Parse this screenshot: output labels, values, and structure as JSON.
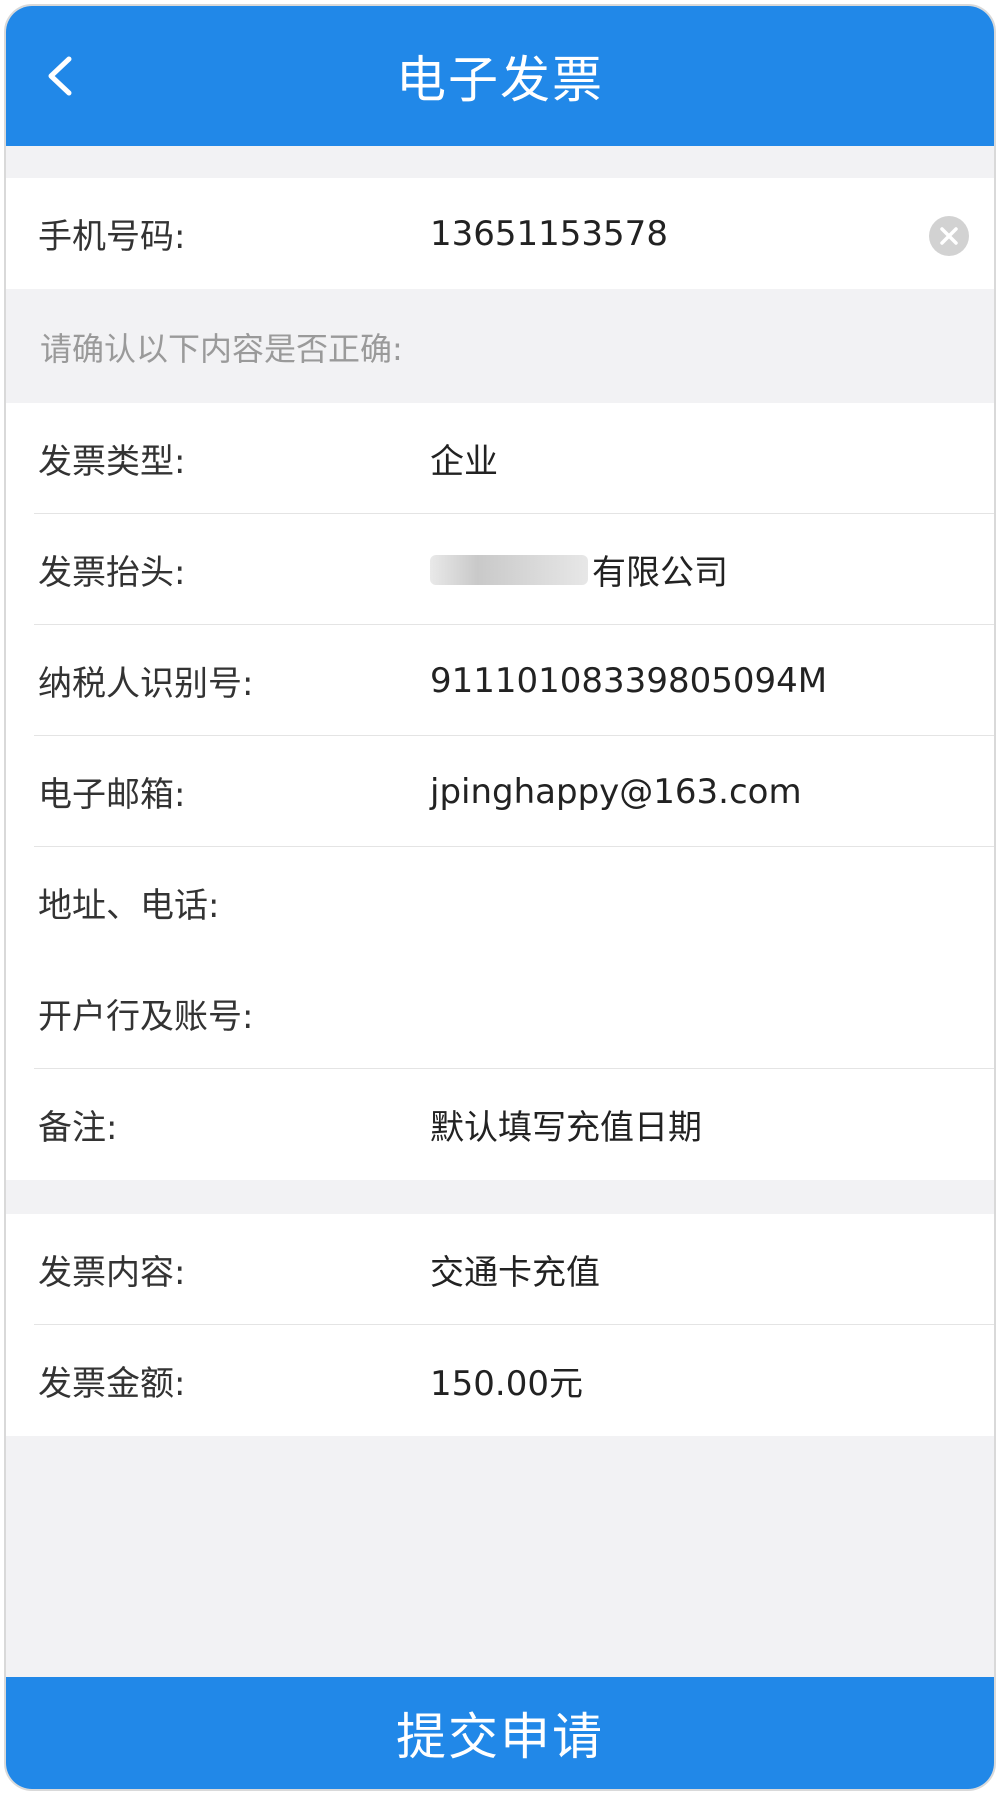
{
  "header": {
    "title": "电子发票"
  },
  "phone": {
    "label": "手机号码:",
    "value": "13651153578"
  },
  "confirm_hint": "请确认以下内容是否正确:",
  "details": [
    {
      "label": "发票类型:",
      "value": "企业"
    },
    {
      "label": "发票抬头:",
      "value": "有限公司"
    },
    {
      "label": "纳税人识别号:",
      "value": "91110108339805094M"
    },
    {
      "label": "电子邮箱:",
      "value": "jpinghappy@163.com"
    },
    {
      "label": "地址、电话:",
      "value": ""
    },
    {
      "label": "开户行及账号:",
      "value": ""
    },
    {
      "label": "备注:",
      "value": "默认填写充值日期"
    }
  ],
  "summary": [
    {
      "label": "发票内容:",
      "value": "交通卡充值"
    },
    {
      "label": "发票金额:",
      "value": "150.00元"
    }
  ],
  "submit_label": "提交申请",
  "colors": {
    "primary": "#2188e8",
    "background": "#f2f2f4"
  }
}
